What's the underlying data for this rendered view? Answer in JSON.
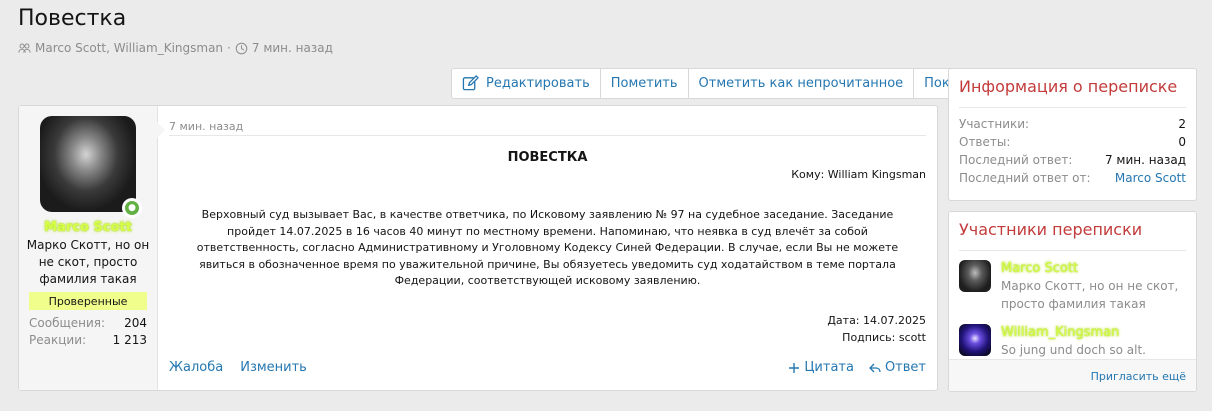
{
  "page": {
    "title": "Повестка",
    "participants_line": "Marco Scott, William_Kingsman",
    "separator": "·",
    "time_ago": "7 мин. назад"
  },
  "actions": {
    "edit": "Редактировать",
    "mark": "Пометить",
    "mark_unread": "Отметить как непрочитанное",
    "leave": "Покинуть"
  },
  "author": {
    "name": "Marco Scott",
    "title": "Марко Скотт, но он не скот, просто фамилия такая",
    "banner": "Проверенные",
    "stats": [
      {
        "label": "Сообщения:",
        "value": "204"
      },
      {
        "label": "Реакции:",
        "value": "1 213"
      }
    ]
  },
  "message": {
    "time": "7 мин. назад",
    "heading": "ПОВЕСТКА",
    "to": "Кому: William Kingsman",
    "body": "Верховный суд вызывает Вас, в качестве ответчика, по Исковому заявлению № 97 на судебное заседание. Заседание пройдет 14.07.2025 в 16 часов 40 минут по местному времени. Напоминаю, что неявка в суд влечёт за собой ответственность, согласно Административному и Уголовному Кодексу Синей Федерации. В случае, если Вы не можете явиться в обозначенное время по уважительной причине, Вы обязуетесь уведомить суд ходатайством в теме портала Федерации, соответствующей исковому заявлению.",
    "date": "Дата: 14.07.2025",
    "signature": "Подпись: scott",
    "report": "Жалоба",
    "edit": "Изменить",
    "quote": "Цитата",
    "reply": "Ответ"
  },
  "info_panel": {
    "title": "Информация о переписке",
    "rows": [
      {
        "label": "Участники:",
        "value": "2"
      },
      {
        "label": "Ответы:",
        "value": "0"
      },
      {
        "label": "Последний ответ:",
        "value": "7 мин. назад"
      },
      {
        "label": "Последний ответ от:",
        "value": "Marco Scott"
      }
    ]
  },
  "participants_panel": {
    "title": "Участники переписки",
    "members": [
      {
        "name": "Marco Scott",
        "desc": "Марко Скотт, но он не скот, просто фамилия такая"
      },
      {
        "name": "William_Kingsman",
        "desc": "So jung und doch so alt."
      }
    ],
    "invite": "Пригласить ещё"
  },
  "colors": {
    "link": "#2577b1",
    "panel_title": "#c33b3b",
    "username_glow": "#d6ff4a",
    "banner": "#f0ff8c",
    "online": "#63b144"
  }
}
